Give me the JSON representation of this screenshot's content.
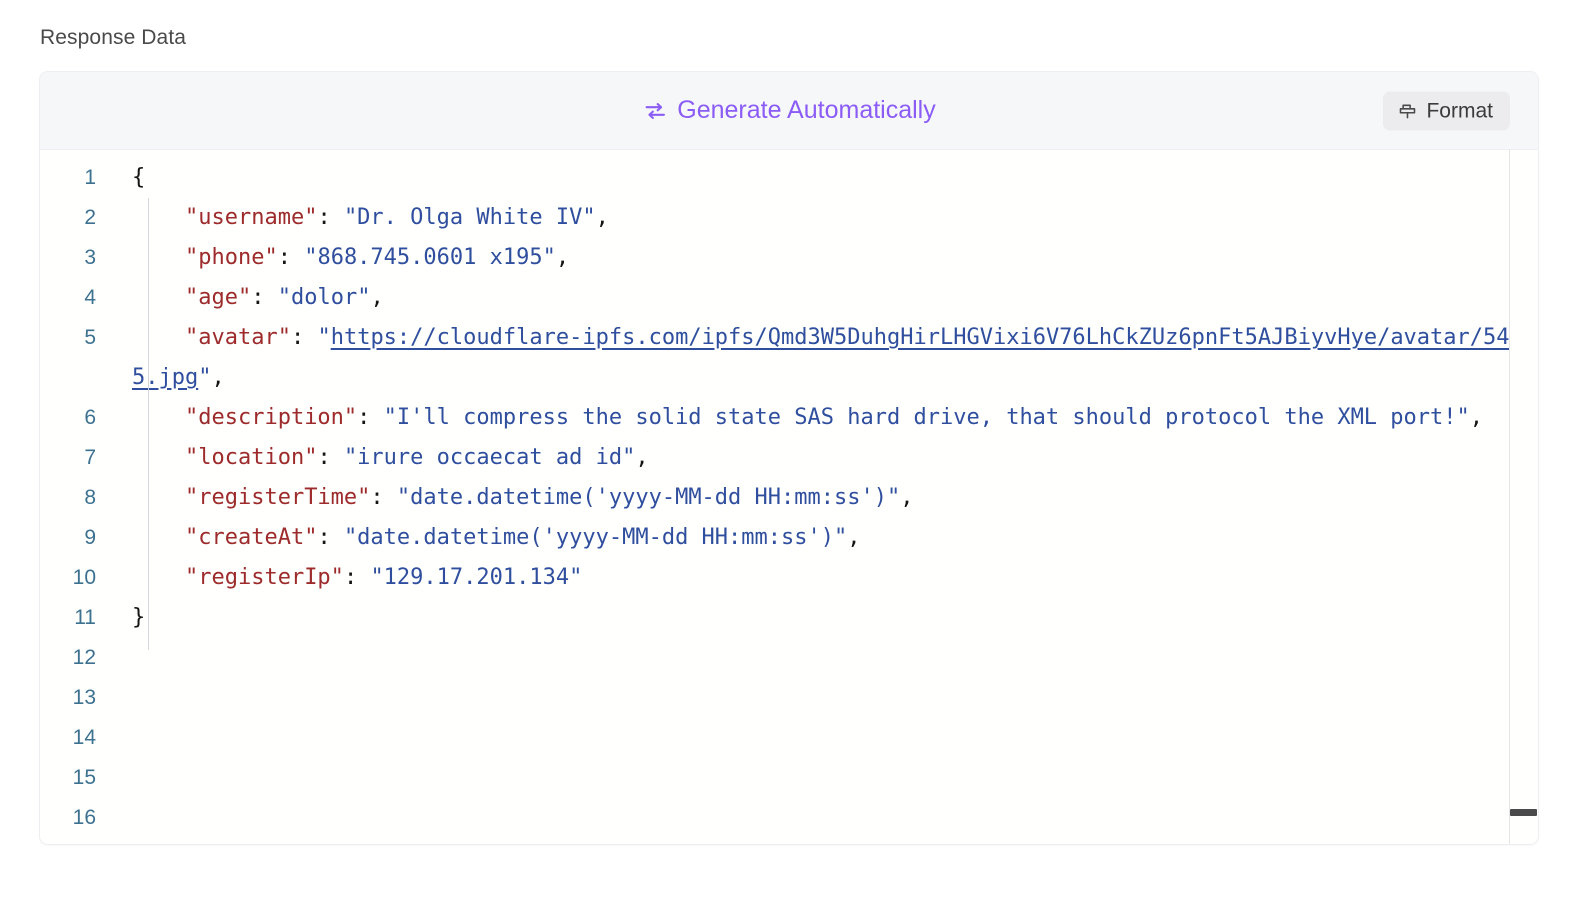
{
  "page_title": "Response Data",
  "toolbar": {
    "generate_label": "Generate Automatically",
    "generate_icon": "swap-arrows-icon",
    "format_label": "Format",
    "format_icon": "format-painter-icon",
    "accent_color": "#8b5cf6",
    "background": "#f6f7f9"
  },
  "editor": {
    "line_number_color": "#3d7190",
    "key_color": "#9d2b2b",
    "string_color": "#2f4f9e",
    "punctuation_color": "#141414",
    "lines": [
      {
        "number": "1",
        "segments": [
          {
            "type": "brace",
            "text": "{"
          }
        ]
      },
      {
        "number": "2",
        "segments": [
          {
            "type": "indent",
            "text": "    "
          },
          {
            "type": "key",
            "text": "\"username\""
          },
          {
            "type": "punc",
            "text": ": "
          },
          {
            "type": "str",
            "text": "\"Dr. Olga White IV\""
          },
          {
            "type": "punc",
            "text": ","
          }
        ]
      },
      {
        "number": "3",
        "segments": [
          {
            "type": "indent",
            "text": "    "
          },
          {
            "type": "key",
            "text": "\"phone\""
          },
          {
            "type": "punc",
            "text": ": "
          },
          {
            "type": "str",
            "text": "\"868.745.0601 x195\""
          },
          {
            "type": "punc",
            "text": ","
          }
        ]
      },
      {
        "number": "4",
        "segments": [
          {
            "type": "indent",
            "text": "    "
          },
          {
            "type": "key",
            "text": "\"age\""
          },
          {
            "type": "punc",
            "text": ": "
          },
          {
            "type": "str",
            "text": "\"dolor\""
          },
          {
            "type": "punc",
            "text": ","
          }
        ]
      },
      {
        "number": "5",
        "segments": [
          {
            "type": "indent",
            "text": "    "
          },
          {
            "type": "key",
            "text": "\"avatar\""
          },
          {
            "type": "punc",
            "text": ": "
          },
          {
            "type": "str",
            "text": "\""
          },
          {
            "type": "link",
            "text": "https://cloudflare-ipfs.com/ipfs/Qmd3W5DuhgHirLHGVixi6V76LhCkZUz6pnFt5AJBiyvHye/avatar/545.jpg"
          },
          {
            "type": "str",
            "text": "\""
          },
          {
            "type": "punc",
            "text": ","
          }
        ]
      },
      {
        "number": "6",
        "segments": [
          {
            "type": "indent",
            "text": "    "
          },
          {
            "type": "key",
            "text": "\"description\""
          },
          {
            "type": "punc",
            "text": ": "
          },
          {
            "type": "str",
            "text": "\"I'll compress the solid state SAS hard drive, that should protocol the XML port!\""
          },
          {
            "type": "punc",
            "text": ","
          }
        ]
      },
      {
        "number": "7",
        "segments": [
          {
            "type": "indent",
            "text": "    "
          },
          {
            "type": "key",
            "text": "\"location\""
          },
          {
            "type": "punc",
            "text": ": "
          },
          {
            "type": "str",
            "text": "\"irure occaecat ad id\""
          },
          {
            "type": "punc",
            "text": ","
          }
        ]
      },
      {
        "number": "8",
        "segments": [
          {
            "type": "indent",
            "text": "    "
          },
          {
            "type": "key",
            "text": "\"registerTime\""
          },
          {
            "type": "punc",
            "text": ": "
          },
          {
            "type": "str",
            "text": "\"date.datetime('yyyy-MM-dd HH:mm:ss')\""
          },
          {
            "type": "punc",
            "text": ","
          }
        ]
      },
      {
        "number": "9",
        "segments": [
          {
            "type": "indent",
            "text": "    "
          },
          {
            "type": "key",
            "text": "\"createAt\""
          },
          {
            "type": "punc",
            "text": ": "
          },
          {
            "type": "str",
            "text": "\"date.datetime('yyyy-MM-dd HH:mm:ss')\""
          },
          {
            "type": "punc",
            "text": ","
          }
        ]
      },
      {
        "number": "10",
        "segments": [
          {
            "type": "indent",
            "text": "    "
          },
          {
            "type": "key",
            "text": "\"registerIp\""
          },
          {
            "type": "punc",
            "text": ": "
          },
          {
            "type": "str",
            "text": "\"129.17.201.134\""
          }
        ]
      },
      {
        "number": "11",
        "segments": [
          {
            "type": "brace",
            "text": "}"
          }
        ]
      },
      {
        "number": "12",
        "segments": []
      },
      {
        "number": "13",
        "segments": []
      },
      {
        "number": "14",
        "segments": []
      },
      {
        "number": "15",
        "segments": []
      },
      {
        "number": "16",
        "segments": []
      }
    ]
  }
}
